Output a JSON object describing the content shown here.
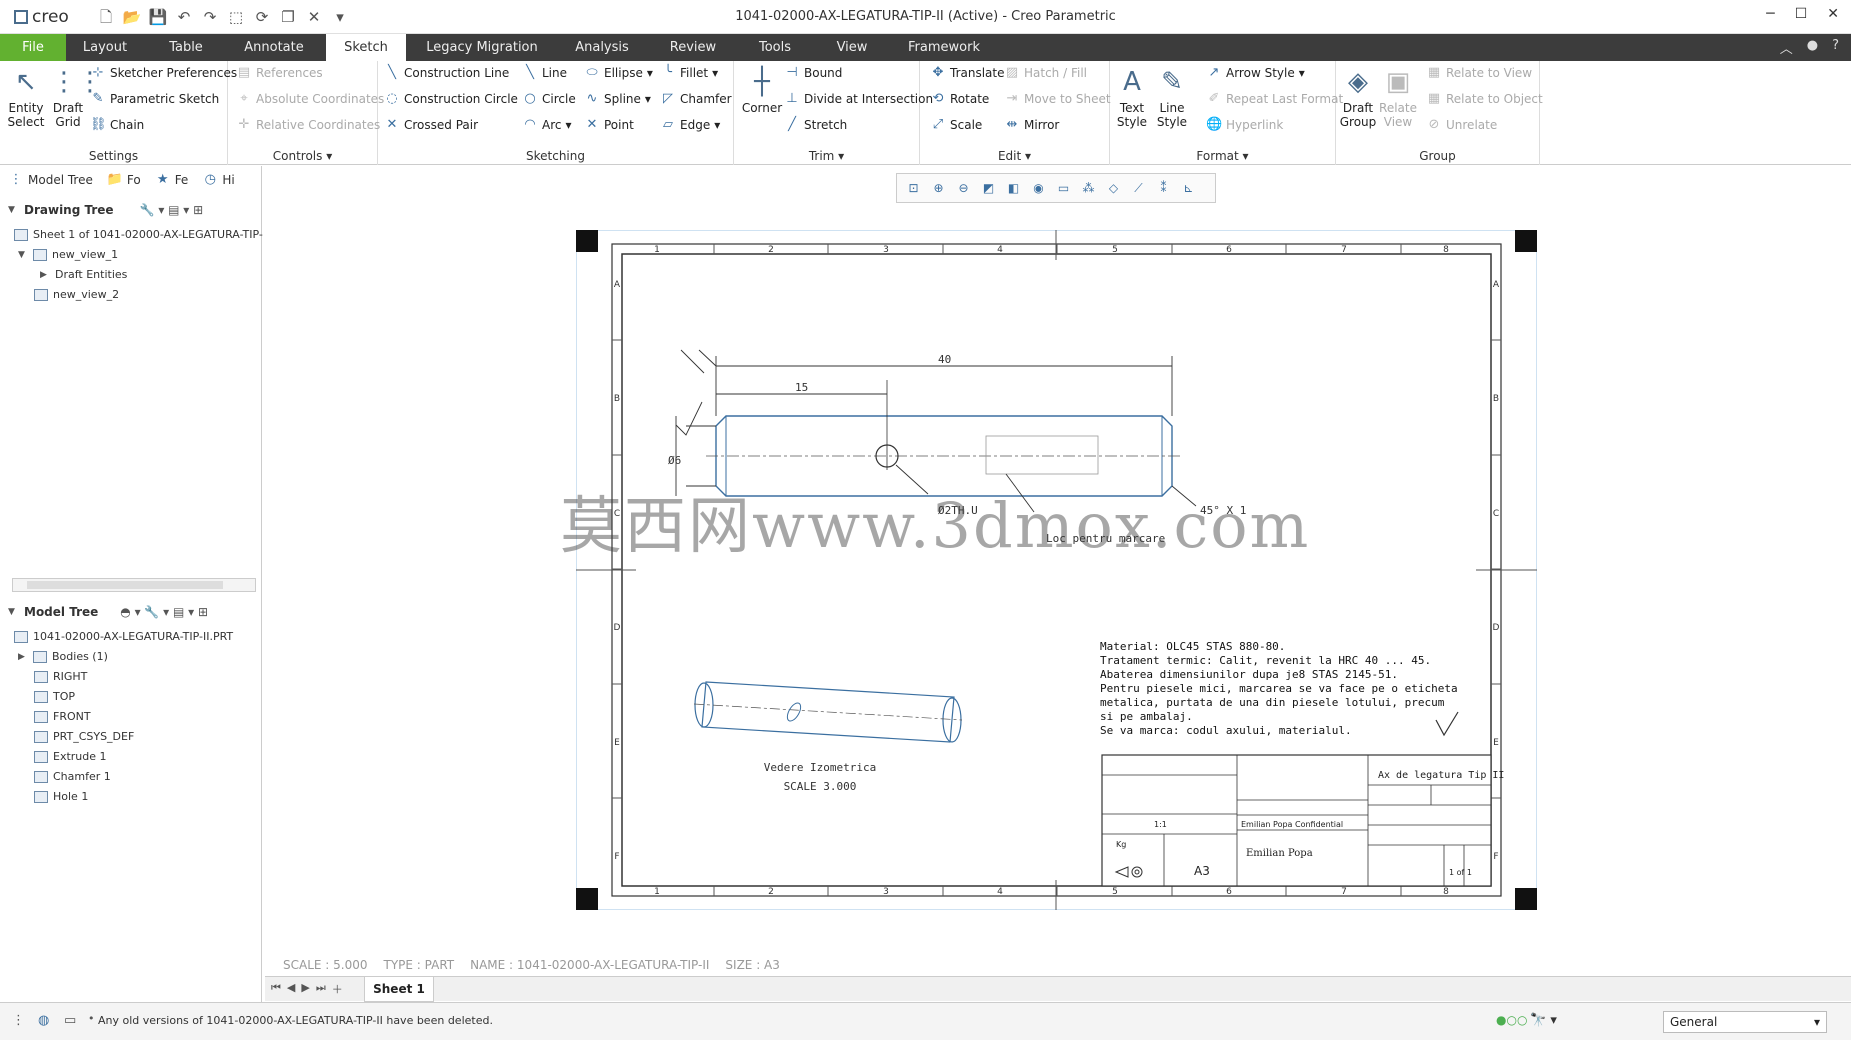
{
  "app": {
    "logo": "creo",
    "window_title": "1041-02000-AX-LEGATURA-TIP-II (Active) - Creo Parametric"
  },
  "tabs": [
    "File",
    "Layout",
    "Table",
    "Annotate",
    "Sketch",
    "Legacy Migration",
    "Analysis",
    "Review",
    "Tools",
    "View",
    "Framework"
  ],
  "ribbon": {
    "settings": {
      "label": "Settings",
      "entity_select": "Entity Select",
      "draft_grid": "Draft Grid",
      "sketcher_preferences": "Sketcher Preferences",
      "parametric_sketch": "Parametric Sketch",
      "chain": "Chain"
    },
    "controls": {
      "label": "Controls",
      "references": "References",
      "absolute_coordinates": "Absolute Coordinates",
      "relative_coordinates": "Relative Coordinates"
    },
    "sketching": {
      "label": "Sketching",
      "construction_line": "Construction Line",
      "construction_circle": "Construction Circle",
      "crossed_pair": "Crossed Pair",
      "line": "Line",
      "circle": "Circle",
      "arc": "Arc",
      "ellipse": "Ellipse",
      "spline": "Spline",
      "point": "Point",
      "fillet": "Fillet",
      "chamfer": "Chamfer",
      "edge": "Edge"
    },
    "trim": {
      "label": "Trim",
      "corner": "Corner",
      "bound": "Bound",
      "divide_at_intersection": "Divide at Intersection",
      "stretch": "Stretch"
    },
    "edit": {
      "label": "Edit",
      "translate": "Translate",
      "rotate": "Rotate",
      "scale": "Scale",
      "hatch_fill": "Hatch / Fill",
      "move_to_sheet": "Move to Sheet",
      "mirror": "Mirror"
    },
    "format": {
      "label": "Format",
      "text_style": "Text Style",
      "line_style": "Line Style",
      "arrow_style": "Arrow Style",
      "repeat_last_format": "Repeat Last Format",
      "hyperlink": "Hyperlink"
    },
    "group": {
      "label": "Group",
      "draft_group": "Draft Group",
      "relate_view": "Relate View",
      "relate_to_view": "Relate to View",
      "relate_to_object": "Relate to Object",
      "unrelate": "Unrelate"
    }
  },
  "left_panel": {
    "tabs": [
      "Model Tree",
      "Fo",
      "Fe",
      "Hi"
    ],
    "drawing_tree_title": "Drawing Tree",
    "drawing_tree": [
      "Sheet 1 of 1041-02000-AX-LEGATURA-TIP-II.",
      "new_view_1",
      "Draft Entities",
      "new_view_2"
    ],
    "model_tree_title": "Model Tree",
    "model_tree": [
      "1041-02000-AX-LEGATURA-TIP-II.PRT",
      "Bodies (1)",
      "RIGHT",
      "TOP",
      "FRONT",
      "PRT_CSYS_DEF",
      "Extrude 1",
      "Chamfer 1",
      "Hole 1"
    ]
  },
  "drawing": {
    "col_labels": [
      "1",
      "2",
      "3",
      "4",
      "5",
      "6",
      "7",
      "8"
    ],
    "row_labels": [
      "A",
      "B",
      "C",
      "D",
      "E",
      "F"
    ],
    "dim_40": "40",
    "dim_15": "15",
    "dim_d6": "Ø6",
    "dim_hole": "Ø2TH.U",
    "dim_chamfer": "45° X 1",
    "marking_note": "Loc pentru marcare",
    "iso_title": "Vedere Izometrica",
    "iso_scale": "SCALE 3.000",
    "notes": [
      "Material: OLC45 STAS 880-80.",
      "Tratament termic: Calit, revenit la HRC 40 ... 45.",
      "Abaterea dimensiunilor dupa je8 STAS 2145-51.",
      "Pentru piesele mici, marcarea se va face pe o eticheta",
      "metalica, purtata de una din piesele lotului, precum",
      "si pe ambalaj.",
      "Se va marca: codul axului, materialul."
    ],
    "tb_description": "Ax de legatura Tip II",
    "tb_confidential": "Emilian Popa Confidential",
    "tb_author": "Emilian Popa",
    "tb_size": "A3",
    "tb_scale": "1:1",
    "tb_sheet": "1 of 1",
    "tb_weight": "Kg"
  },
  "status_info": [
    "SCALE : 5.000",
    "TYPE : PART",
    "NAME : 1041-02000-AX-LEGATURA-TIP-II",
    "SIZE : A3"
  ],
  "sheet_tab": "Sheet 1",
  "status_message": "Any old versions of 1041-02000-AX-LEGATURA-TIP-II have been deleted.",
  "filter_value": "General",
  "watermark": "莫西网www.3dmox.com"
}
